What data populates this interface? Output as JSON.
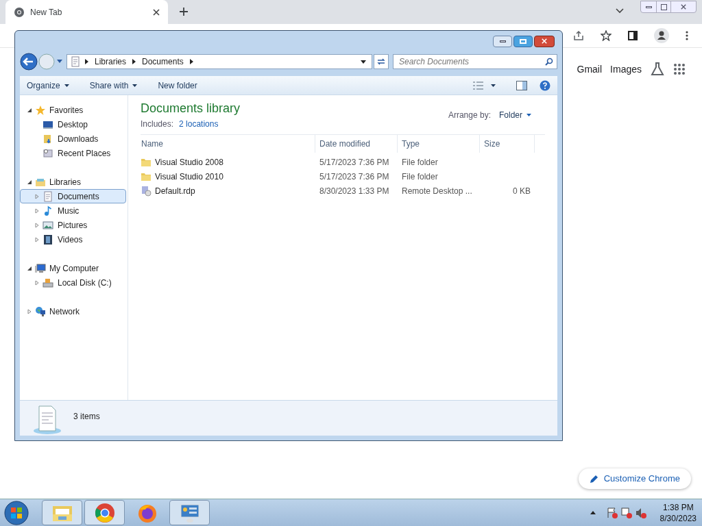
{
  "browser": {
    "tab": {
      "title": "New Tab"
    },
    "page_links": [
      "Gmail",
      "Images"
    ],
    "customize_button": "Customize Chrome"
  },
  "explorer": {
    "breadcrumb": [
      "Libraries",
      "Documents"
    ],
    "search": {
      "placeholder": "Search Documents"
    },
    "commands": [
      {
        "label": "Organize",
        "dropdown": true
      },
      {
        "label": "Share with",
        "dropdown": true
      },
      {
        "label": "New folder",
        "dropdown": false
      }
    ],
    "nav": [
      {
        "label": "Favorites",
        "kind": "star",
        "expanded": true,
        "children": [
          {
            "label": "Desktop",
            "kind": "desktop",
            "selected": false
          },
          {
            "label": "Downloads",
            "kind": "downloads",
            "selected": false
          },
          {
            "label": "Recent Places",
            "kind": "recent",
            "selected": false
          }
        ]
      },
      {
        "label": "Libraries",
        "kind": "library",
        "expanded": true,
        "children": [
          {
            "label": "Documents",
            "kind": "document",
            "selected": true,
            "expanded": false
          },
          {
            "label": "Music",
            "kind": "music",
            "selected": false,
            "expanded": false
          },
          {
            "label": "Pictures",
            "kind": "pictures",
            "selected": false,
            "expanded": false
          },
          {
            "label": "Videos",
            "kind": "videos",
            "selected": false,
            "expanded": false
          }
        ]
      },
      {
        "label": "My Computer",
        "kind": "computer",
        "expanded": true,
        "children": [
          {
            "label": "Local Disk (C:)",
            "kind": "disk",
            "selected": false,
            "expanded": false
          }
        ]
      },
      {
        "label": "Network",
        "kind": "network",
        "expanded": false
      }
    ],
    "library": {
      "title": "Documents library",
      "includes_label": "Includes:",
      "includes_link": "2 locations",
      "arrange_label": "Arrange by:",
      "arrange_value": "Folder"
    },
    "columns": [
      "Name",
      "Date modified",
      "Type",
      "Size"
    ],
    "rows": [
      {
        "name": "Visual Studio 2008",
        "date": "5/17/2023 7:36 PM",
        "type": "File folder",
        "kind": "folder"
      },
      {
        "name": "Visual Studio 2010",
        "date": "5/17/2023 7:36 PM",
        "type": "File folder",
        "kind": "folder"
      },
      {
        "name": "Default.rdp",
        "date": "8/30/2023 1:33 PM",
        "type": "Remote Desktop ...",
        "size": "0 KB",
        "kind": "rdp"
      }
    ],
    "status": "3 items"
  },
  "taskbar": {
    "apps": [
      {
        "kind": "explorer",
        "selected": true
      },
      {
        "kind": "chrome",
        "selected": true
      },
      {
        "kind": "firefox",
        "selected": false
      },
      {
        "kind": "control",
        "selected": true
      }
    ],
    "time": "1:38 PM",
    "date": "8/30/2023"
  }
}
